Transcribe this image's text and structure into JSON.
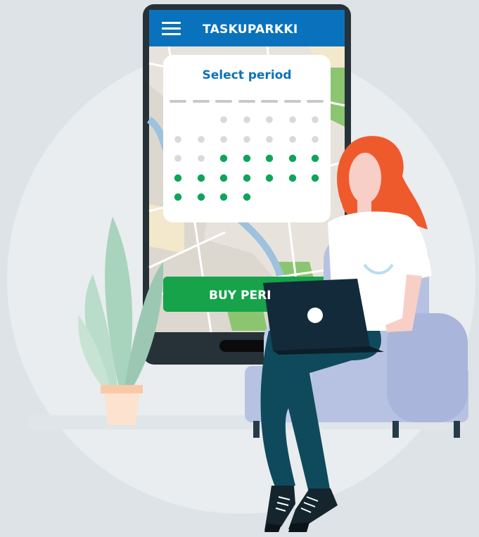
{
  "app": {
    "title": "TASKUPARKKI"
  },
  "card": {
    "title": "Select period"
  },
  "cta": {
    "label": "BUY PERMIT",
    "visible_label": "BUY PERI"
  },
  "calendar": {
    "rows": [
      [
        "none",
        "none",
        "gray",
        "gray",
        "gray",
        "gray",
        "gray"
      ],
      [
        "gray",
        "gray",
        "gray",
        "gray",
        "gray",
        "gray",
        "gray"
      ],
      [
        "gray",
        "gray",
        "green",
        "green",
        "green",
        "green",
        "green"
      ],
      [
        "green",
        "green",
        "green",
        "green",
        "green",
        "green",
        "green"
      ],
      [
        "green",
        "green",
        "green",
        "green",
        "none",
        "none",
        "none"
      ]
    ]
  },
  "colors": {
    "header": "#0a72bd",
    "accent_green": "#16a34a",
    "selected_day": "#0ea55a",
    "inactive_day": "#d9d9d9",
    "background_circle": "#e9edef",
    "hair": "#ef5a2d"
  },
  "icons": {
    "menu": "hamburger-menu-icon",
    "laptop_logo": "laptop-logo-icon"
  }
}
